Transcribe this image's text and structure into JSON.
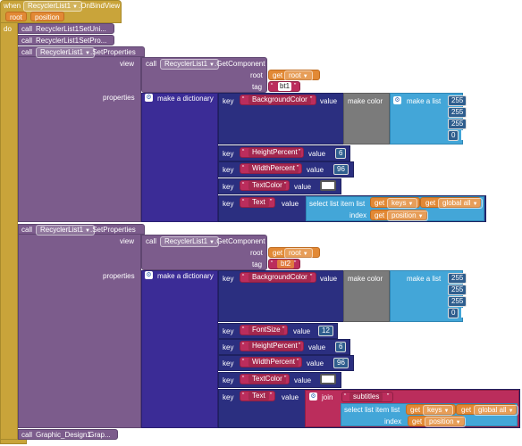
{
  "event": {
    "when": "when",
    "component": "RecyclerList1",
    "event_name": ".OnBindView",
    "param1": "root",
    "param2": "position",
    "do": "do"
  },
  "calls": {
    "call": "call",
    "setuni_comp": "RecyclerList1",
    "setuni_method": ".SetUni...",
    "setpro_comp": "RecyclerList1",
    "setpro_method": ".SetPro...",
    "setprops_comp": "RecyclerList1",
    "setprops_method": ".SetProperties",
    "graphic_comp": "Graphic_Design1",
    "graphic_method": ".Grap..."
  },
  "block1": {
    "view_label": "view",
    "getcomp_comp": "RecyclerList1",
    "getcomp_method": ".GetComponent",
    "root_label": "root",
    "get_label": "get",
    "get_root": "root",
    "tag_label": "tag",
    "tag_value": "bt1",
    "properties_label": "properties",
    "make_dict": "make a dictionary",
    "key_label": "key",
    "value_label": "value",
    "make_color": "make color",
    "make_list": "make a list",
    "bg_key": "BackgroundColor",
    "color_values": [
      "255",
      "255",
      "255",
      "0"
    ],
    "height_key": "HeightPercent",
    "height_value": "6",
    "width_key": "WidthPercent",
    "width_value": "96",
    "textcolor_key": "TextColor",
    "text_key": "Text",
    "select_item": "select list item  list",
    "get_keys": "keys",
    "get_global": "global all",
    "index_label": "index",
    "get_position": "position"
  },
  "block2": {
    "tag_value": "bt2",
    "fontsize_key": "FontSize",
    "fontsize_value": "12",
    "join_label": "join",
    "subtitles": "subtitles"
  }
}
